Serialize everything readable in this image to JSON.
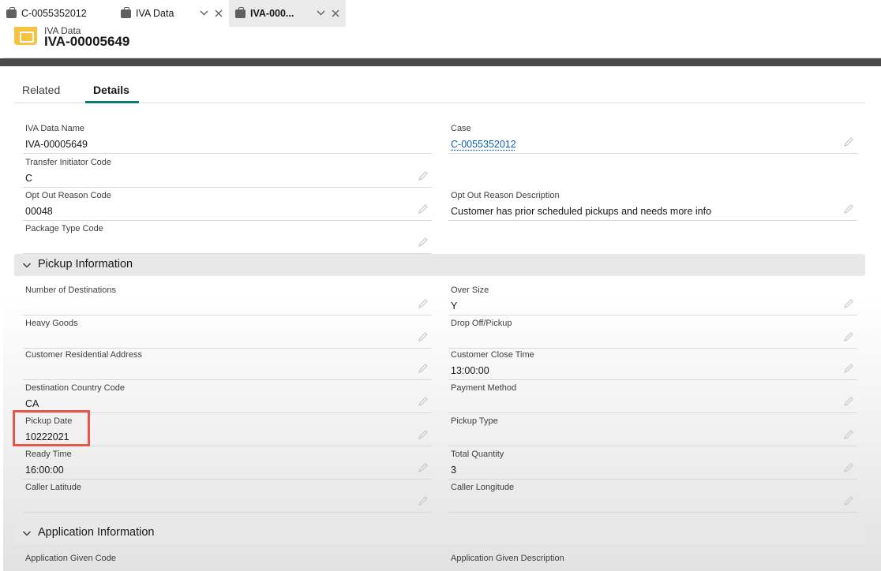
{
  "tabs": [
    {
      "label": "C-0055352012"
    },
    {
      "label": "IVA Data"
    },
    {
      "label": "IVA-000..."
    }
  ],
  "header": {
    "object_type": "IVA Data",
    "record_name": "IVA-00005649"
  },
  "record_tabs": {
    "related": "Related",
    "details": "Details"
  },
  "fields": {
    "iva_data_name": {
      "label": "IVA Data Name",
      "value": "IVA-00005649"
    },
    "case": {
      "label": "Case",
      "value": "C-0055352012"
    },
    "transfer_initiator_code": {
      "label": "Transfer Initiator Code",
      "value": "C"
    },
    "opt_out_reason_code": {
      "label": "Opt Out Reason Code",
      "value": "00048"
    },
    "opt_out_reason_description": {
      "label": "Opt Out Reason Description",
      "value": "Customer has prior scheduled pickups and needs more info"
    },
    "package_type_code": {
      "label": "Package Type Code",
      "value": ""
    }
  },
  "sections": {
    "pickup": {
      "title": "Pickup Information",
      "fields": {
        "number_of_destinations": {
          "label": "Number of Destinations",
          "value": ""
        },
        "over_size": {
          "label": "Over Size",
          "value": "Y"
        },
        "heavy_goods": {
          "label": "Heavy Goods",
          "value": ""
        },
        "drop_off_pickup": {
          "label": "Drop Off/Pickup",
          "value": ""
        },
        "customer_residential_address": {
          "label": "Customer Residential Address",
          "value": ""
        },
        "customer_close_time": {
          "label": "Customer Close Time",
          "value": "13:00:00"
        },
        "destination_country_code": {
          "label": "Destination Country Code",
          "value": "CA"
        },
        "payment_method": {
          "label": "Payment Method",
          "value": ""
        },
        "pickup_date": {
          "label": "Pickup Date",
          "value": "10222021"
        },
        "pickup_type": {
          "label": "Pickup Type",
          "value": ""
        },
        "ready_time": {
          "label": "Ready Time",
          "value": "16:00:00"
        },
        "total_quantity": {
          "label": "Total Quantity",
          "value": "3"
        },
        "caller_latitude": {
          "label": "Caller Latitude",
          "value": ""
        },
        "caller_longitude": {
          "label": "Caller Longitude",
          "value": ""
        }
      }
    },
    "application": {
      "title": "Application Information",
      "fields": {
        "application_given_code": {
          "label": "Application Given Code",
          "value": ""
        },
        "application_given_description": {
          "label": "Application Given Description",
          "value": ""
        }
      }
    }
  },
  "colors": {
    "accent": "#0b7a75",
    "link": "#0b5cab",
    "highlight": "#e5574a",
    "object_icon": "#f5c242"
  },
  "icons": {
    "tab": "briefcase-icon",
    "object": "iva-data-icon",
    "edit": "pencil-icon",
    "collapse": "chevron-down-icon",
    "close": "close-icon",
    "menu": "chevron-down-icon"
  }
}
